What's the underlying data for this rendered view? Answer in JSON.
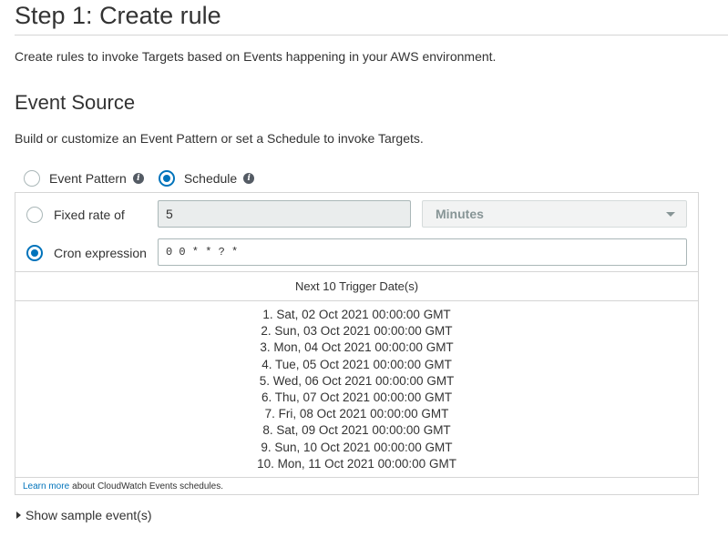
{
  "page": {
    "title": "Step 1: Create rule",
    "intro": "Create rules to invoke Targets based on Events happening in your AWS environment."
  },
  "event_source": {
    "title": "Event Source",
    "description": "Build or customize an Event Pattern or set a Schedule to invoke Targets.",
    "options": [
      {
        "label": "Event Pattern",
        "selected": false
      },
      {
        "label": "Schedule",
        "selected": true
      }
    ],
    "info_icon": "info-icon"
  },
  "schedule": {
    "fixed_rate_label": "Fixed rate of",
    "fixed_rate_value": "5",
    "unit_value": "Minutes",
    "cron_label": "Cron expression",
    "cron_value": "0 0 * * ? *",
    "selected": "cron"
  },
  "triggers": {
    "header": "Next 10 Trigger Date(s)",
    "dates": [
      "1. Sat, 02 Oct 2021 00:00:00 GMT",
      "2. Sun, 03 Oct 2021 00:00:00 GMT",
      "3. Mon, 04 Oct 2021 00:00:00 GMT",
      "4. Tue, 05 Oct 2021 00:00:00 GMT",
      "5. Wed, 06 Oct 2021 00:00:00 GMT",
      "6. Thu, 07 Oct 2021 00:00:00 GMT",
      "7. Fri, 08 Oct 2021 00:00:00 GMT",
      "8. Sat, 09 Oct 2021 00:00:00 GMT",
      "9. Sun, 10 Oct 2021 00:00:00 GMT",
      "10. Mon, 11 Oct 2021 00:00:00 GMT"
    ]
  },
  "footer": {
    "learn_more": "Learn more",
    "text": "about CloudWatch Events schedules."
  },
  "sample": {
    "label": "Show sample event(s)"
  },
  "colors": {
    "accent": "#0073bb",
    "border": "#d5d5d5",
    "text": "#333333"
  }
}
